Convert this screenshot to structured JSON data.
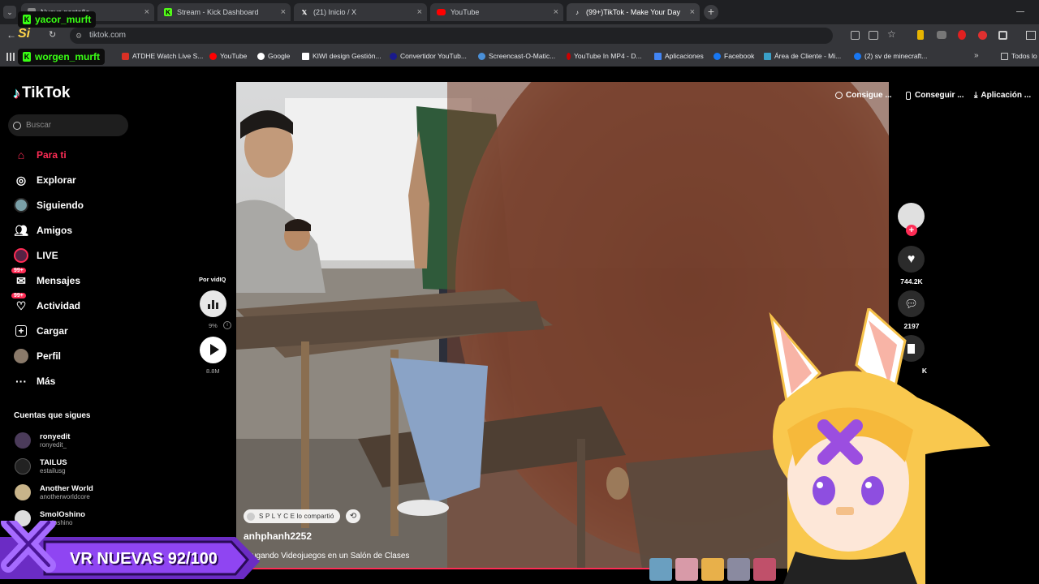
{
  "browser": {
    "tabs": [
      {
        "label": "Nueva pestaña",
        "icon": "new-tab-icon"
      },
      {
        "label": "Stream - Kick Dashboard",
        "icon": "kick-icon"
      },
      {
        "label": "(21) Inicio / X",
        "icon": "x-icon"
      },
      {
        "label": "YouTube",
        "icon": "youtube-icon"
      },
      {
        "label": "(99+)TikTok - Make Your Day",
        "icon": "tiktok-icon"
      }
    ],
    "new_tab_symbol": "+",
    "url": "tiktok.com",
    "bookmarks": [
      {
        "label": "ATDHE Watch Live S...",
        "color": "#d93025"
      },
      {
        "label": "YouTube",
        "color": "#ff0000"
      },
      {
        "label": "Google",
        "color": "#ffffff"
      },
      {
        "label": "KIWI design Gestión...",
        "color": "#ffffff"
      },
      {
        "label": "Convertidor YouTub...",
        "color": "#1a1a8c"
      },
      {
        "label": "Screencast-O-Matic...",
        "color": "#4a90d9"
      },
      {
        "label": "YouTube In MP4 - D...",
        "color": "#cc0000"
      },
      {
        "label": "Aplicaciones",
        "color": "#4285f4"
      },
      {
        "label": "Facebook",
        "color": "#1877f2"
      },
      {
        "label": "Área de Cliente - Mi...",
        "color": "#3aa0c8"
      },
      {
        "label": "(2) sv de minecraft...",
        "color": "#1877f2"
      }
    ],
    "all_bookmarks": "Todos lo"
  },
  "overlay": {
    "streamer_top": "yacor_murft",
    "streamer_bm": "worgen_murft",
    "kick_letter": "K",
    "logo_small": "Si",
    "banner": "VR NUEVAS 92/100"
  },
  "tiktok": {
    "logo": "TikTok",
    "search_placeholder": "Buscar",
    "nav": [
      {
        "label": "Para ti",
        "icon": "home-icon",
        "active": true
      },
      {
        "label": "Explorar",
        "icon": "compass-icon"
      },
      {
        "label": "Siguiendo",
        "icon": "following-avatar-icon"
      },
      {
        "label": "Amigos",
        "icon": "friends-icon"
      },
      {
        "label": "LIVE",
        "icon": "live-icon"
      },
      {
        "label": "Mensajes",
        "icon": "messages-icon",
        "badge": "99+"
      },
      {
        "label": "Actividad",
        "icon": "activity-icon",
        "badge": "99+"
      },
      {
        "label": "Cargar",
        "icon": "upload-icon"
      },
      {
        "label": "Perfil",
        "icon": "profile-avatar-icon"
      },
      {
        "label": "Más",
        "icon": "more-icon"
      }
    ],
    "following_header": "Cuentas que sigues",
    "following": [
      {
        "name": "ronyedit",
        "user": "ronyedit_"
      },
      {
        "name": "TAILUS",
        "user": "estailusg"
      },
      {
        "name": "Another World",
        "user": "anotherworldcore"
      },
      {
        "name": "SmolOshino",
        "user": "smoloshino"
      }
    ],
    "vidiq": {
      "label": "Por vidIQ",
      "percent": "9%",
      "views": "8.8M"
    },
    "top_actions": [
      "Consigue ...",
      "Conseguir ...",
      "Aplicación ..."
    ],
    "rail": {
      "likes": "744.2K",
      "comments": "2197",
      "saves": "K"
    },
    "video": {
      "shared_by": "S P L Y C E lo compartió",
      "author": "anhphanh2252",
      "caption": "Jugando Videojuegos en un Salón de Clases"
    }
  }
}
